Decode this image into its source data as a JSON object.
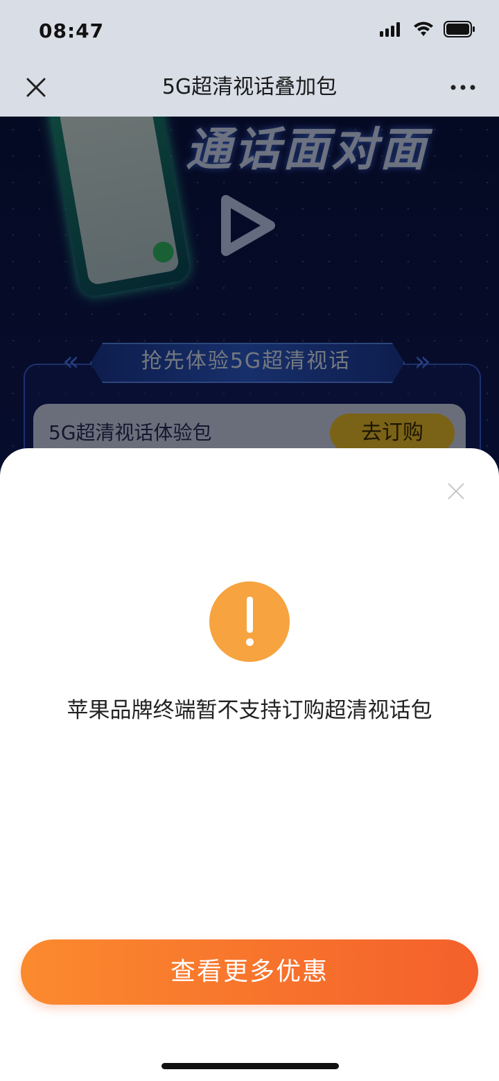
{
  "status_bar": {
    "time": "08:47"
  },
  "nav": {
    "title": "5G超清视话叠加包"
  },
  "background": {
    "hero_text": "通话面对面",
    "banner": "抢先体验5G超清视话",
    "package_name": "5G超清视话体验包",
    "package_button": "去订购"
  },
  "modal": {
    "message": "苹果品牌终端暂不支持订购超清视话包",
    "button_label": "查看更多优惠",
    "alert_color": "#f6a340",
    "button_color": "#f4602b"
  }
}
